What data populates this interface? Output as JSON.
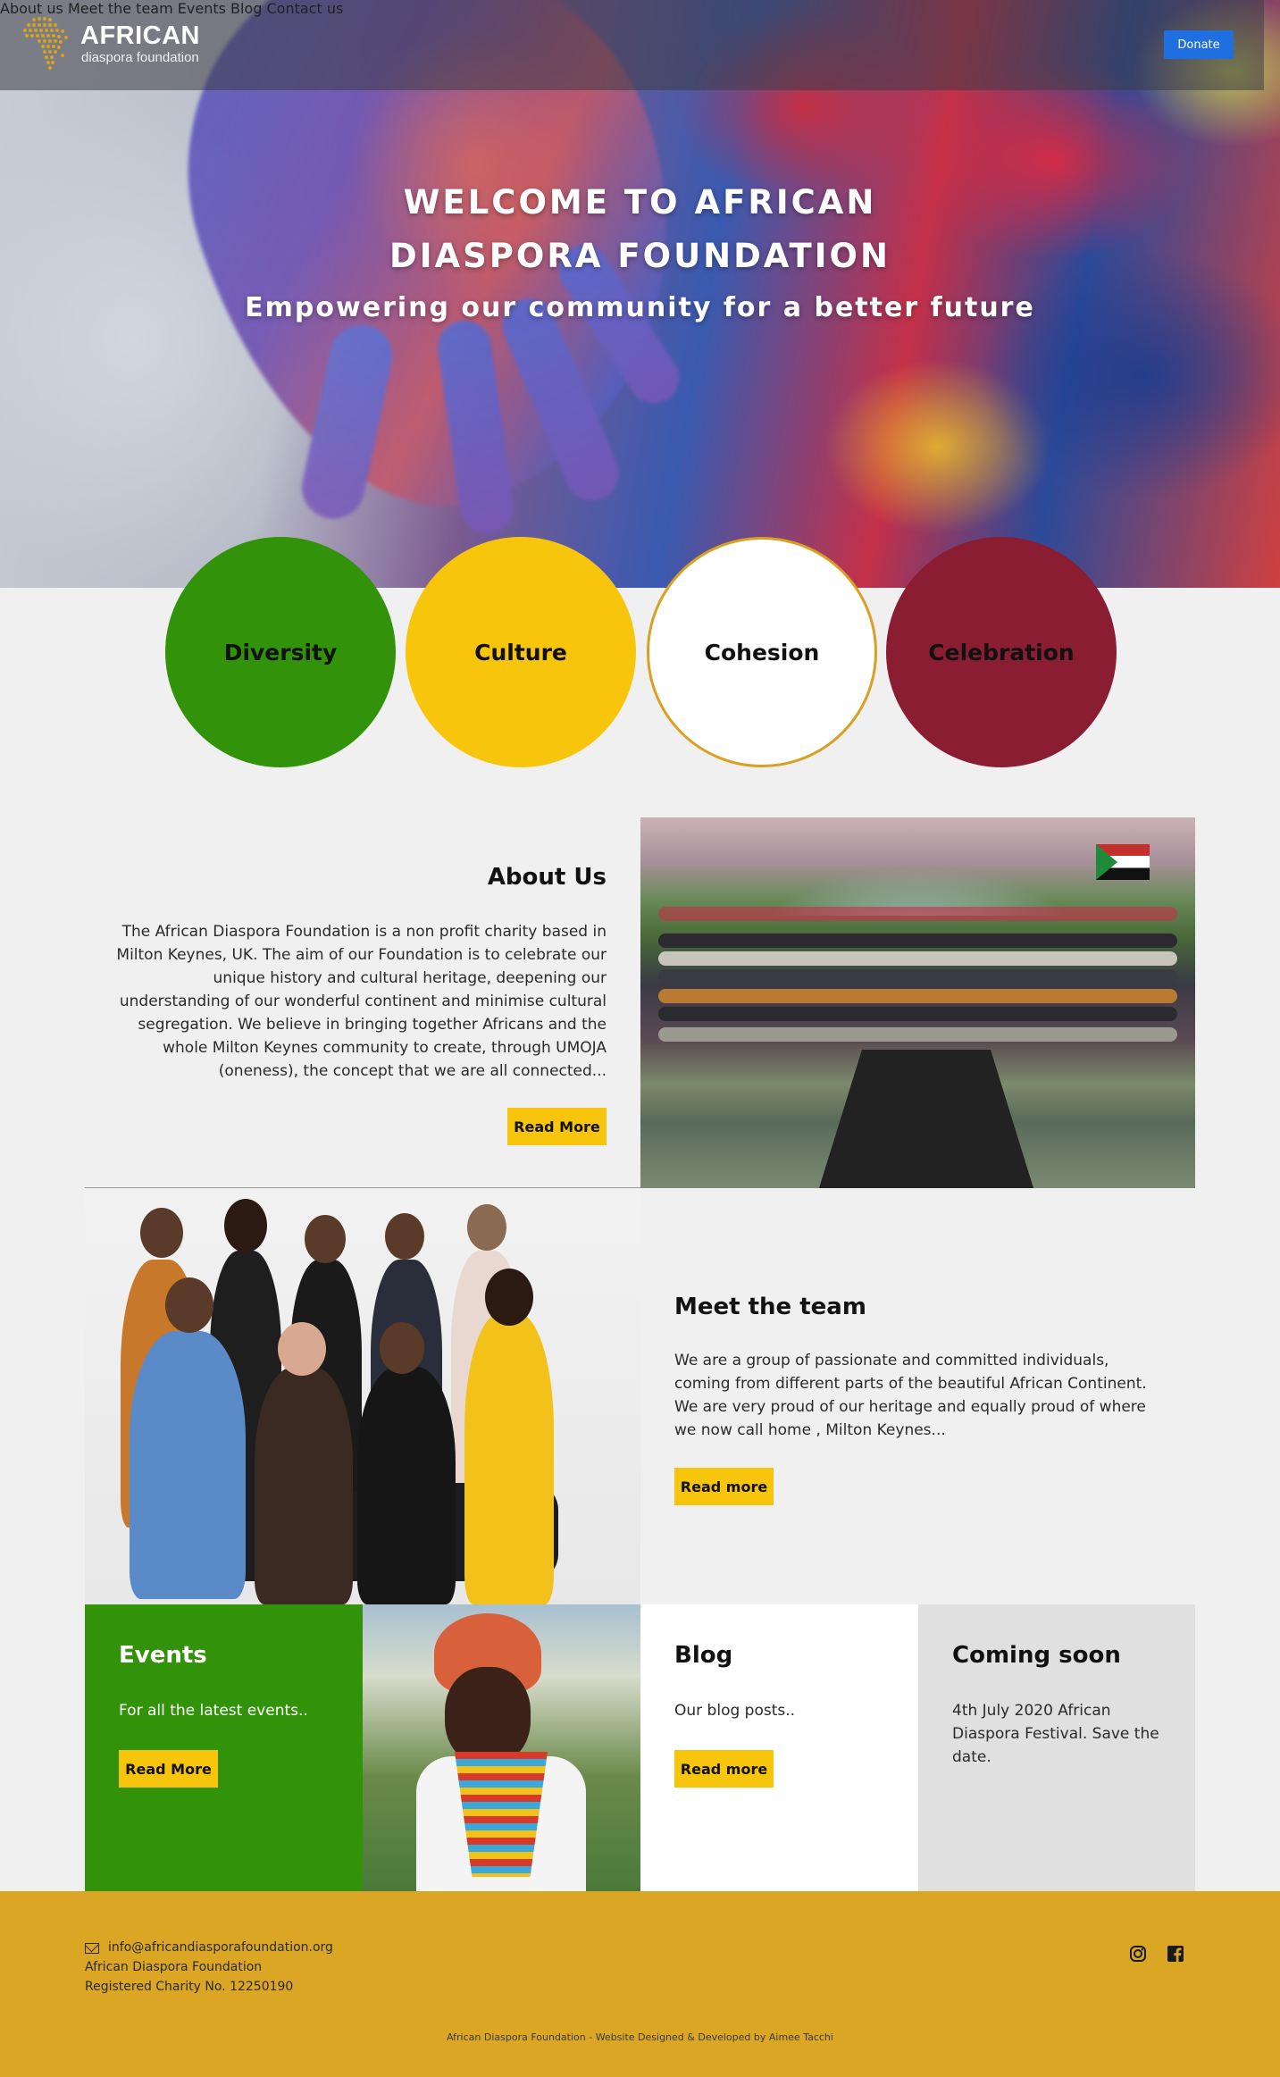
{
  "header": {
    "logo_name": "AFRICAN",
    "logo_sub": "diaspora foundation",
    "nav": [
      "About us",
      "Meet the team",
      "Events",
      "Blog",
      "Contact us"
    ],
    "donate": "Donate"
  },
  "hero": {
    "title_line1": "WELCOME TO AFRICAN",
    "title_line2": "DIASPORA FOUNDATION",
    "subtitle": "Empowering our community for a better future"
  },
  "values": [
    "Diversity",
    "Culture",
    "Cohesion",
    "Celebration"
  ],
  "about": {
    "title": "About Us",
    "body": "The African Diaspora Foundation is a non profit charity based in Milton Keynes, UK. The aim of our Foundation is to celebrate our unique history and cultural heritage, deepening our understanding of our wonderful continent and minimise cultural segregation. We believe in bringing together Africans and the whole Milton Keynes community to create, through UMOJA (oneness), the concept that we are all connected...",
    "button": "Read More"
  },
  "team": {
    "title": "Meet the team",
    "body": "We are a group of passionate and committed individuals, coming from different parts of the beautiful African Continent. We are very proud of our heritage and equally proud of where we now call home , Milton Keynes...",
    "button": "Read more"
  },
  "cards": {
    "events": {
      "title": "Events",
      "text": "For all the latest events..",
      "button": "Read More"
    },
    "blog": {
      "title": "Blog",
      "text": "Our blog posts..",
      "button": "Read more"
    },
    "soon": {
      "title": "Coming soon",
      "text": "4th July 2020 African Diaspora Festival. Save the date."
    }
  },
  "footer": {
    "email": "info@africandiasporafoundation.org",
    "org": "African Diaspora Foundation",
    "charity": "Registered Charity No. 12250190",
    "credit": "African Diaspora Foundation - Website Designed & Developed by Aimee Tacchi"
  },
  "colors": {
    "green": "#32920a",
    "yellow": "#f7c50c",
    "maroon": "#8a1d32",
    "gold": "#dba623",
    "donate_blue": "#1f6fe0"
  }
}
